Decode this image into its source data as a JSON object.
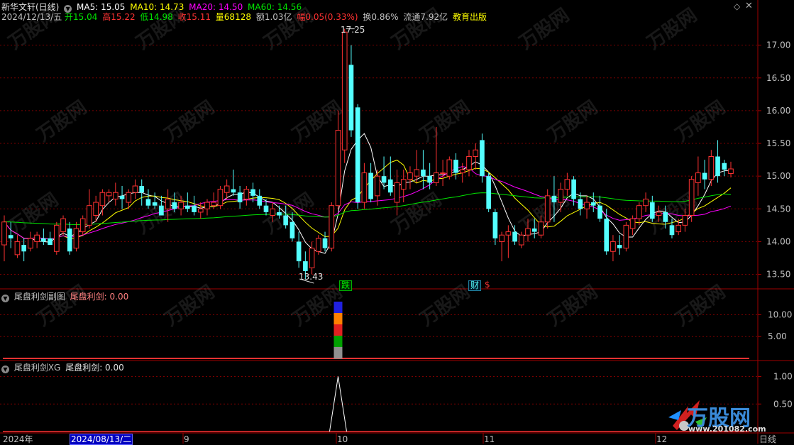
{
  "header": {
    "stock_name": "新华文轩(日线)",
    "ma5": "MA5: 15.05",
    "ma10": "MA10: 14.73",
    "ma20": "MA20: 14.50",
    "ma60": "MA60: 14.56",
    "date": "2024/12/13/五",
    "open": "开15.04",
    "high": "高15.22",
    "low": "低14.98",
    "close": "收15.11",
    "volume": "量68128",
    "amount": "额1.03亿",
    "change": "幅0.05(0.33%)",
    "turnover": "换0.86%",
    "float_cap": "流通7.92亿",
    "sector": "教育出版"
  },
  "colors": {
    "up": "#ff3232",
    "down": "#54ffff",
    "ma5": "#ffffff",
    "ma10": "#ffff00",
    "ma20": "#ff00ff",
    "ma60": "#00e600",
    "grid": "#7a0000",
    "axis_text": "#c0c0c0"
  },
  "price_axis": {
    "ticks": [
      "17.00",
      "16.50",
      "16.00",
      "15.50",
      "15.00",
      "14.50",
      "14.00",
      "13.50"
    ],
    "max_label": "17.25",
    "min_label": "13.43"
  },
  "markers": {
    "down_label": "跌",
    "fin_label": "财",
    "dollar_label": "$"
  },
  "indicator1": {
    "title": "尾盘利剑副图",
    "value": "尾盘利剑: 0.00",
    "ticks": [
      "10.00",
      "5.00"
    ]
  },
  "indicator2": {
    "title": "尾盘利剑XG",
    "value": "尾盘利剑: 0.00",
    "ticks": [
      "1.00",
      "0.50"
    ]
  },
  "time_axis": {
    "year_label": "2024年",
    "cursor_date": "2024/08/13/二",
    "months": [
      "9",
      "10",
      "11",
      "12"
    ],
    "period_label": "日线"
  },
  "watermark": {
    "brand": "万股网",
    "url": "www.201082.com"
  },
  "chart_data": {
    "type": "candlestick",
    "y_range": [
      13.3,
      17.3
    ],
    "candles": [
      {
        "o": 13.95,
        "h": 14.4,
        "l": 13.7,
        "c": 14.3
      },
      {
        "o": 14.1,
        "h": 14.3,
        "l": 13.9,
        "c": 14.05
      },
      {
        "o": 13.8,
        "h": 14.1,
        "l": 13.75,
        "c": 14.0
      },
      {
        "o": 13.95,
        "h": 14.05,
        "l": 13.7,
        "c": 13.85
      },
      {
        "o": 13.9,
        "h": 14.15,
        "l": 13.85,
        "c": 14.05
      },
      {
        "o": 14.0,
        "h": 14.15,
        "l": 13.9,
        "c": 14.1
      },
      {
        "o": 14.05,
        "h": 14.2,
        "l": 13.95,
        "c": 14.0
      },
      {
        "o": 14.05,
        "h": 14.15,
        "l": 13.95,
        "c": 13.95
      },
      {
        "o": 13.85,
        "h": 14.3,
        "l": 13.8,
        "c": 14.25
      },
      {
        "o": 14.15,
        "h": 14.4,
        "l": 14.1,
        "c": 14.35
      },
      {
        "o": 14.2,
        "h": 14.3,
        "l": 13.8,
        "c": 13.85
      },
      {
        "o": 13.9,
        "h": 14.3,
        "l": 13.85,
        "c": 14.2
      },
      {
        "o": 14.15,
        "h": 14.4,
        "l": 14.1,
        "c": 14.35
      },
      {
        "o": 14.25,
        "h": 14.8,
        "l": 14.2,
        "c": 14.55
      },
      {
        "o": 14.4,
        "h": 14.7,
        "l": 14.3,
        "c": 14.6
      },
      {
        "o": 14.55,
        "h": 14.8,
        "l": 14.4,
        "c": 14.75
      },
      {
        "o": 14.7,
        "h": 14.8,
        "l": 14.6,
        "c": 14.75
      },
      {
        "o": 14.65,
        "h": 14.9,
        "l": 14.55,
        "c": 14.75
      },
      {
        "o": 14.7,
        "h": 14.85,
        "l": 14.5,
        "c": 14.65
      },
      {
        "o": 14.6,
        "h": 14.8,
        "l": 14.5,
        "c": 14.75
      },
      {
        "o": 14.75,
        "h": 14.95,
        "l": 14.65,
        "c": 14.85
      },
      {
        "o": 14.85,
        "h": 14.95,
        "l": 14.55,
        "c": 14.75
      },
      {
        "o": 14.65,
        "h": 14.8,
        "l": 14.5,
        "c": 14.55
      },
      {
        "o": 14.6,
        "h": 14.75,
        "l": 14.5,
        "c": 14.55
      },
      {
        "o": 14.55,
        "h": 14.7,
        "l": 14.4,
        "c": 14.4
      },
      {
        "o": 14.5,
        "h": 14.8,
        "l": 14.3,
        "c": 14.65
      },
      {
        "o": 14.6,
        "h": 14.75,
        "l": 14.45,
        "c": 14.5
      },
      {
        "o": 14.5,
        "h": 14.7,
        "l": 14.4,
        "c": 14.6
      },
      {
        "o": 14.55,
        "h": 14.75,
        "l": 14.45,
        "c": 14.5
      },
      {
        "o": 14.55,
        "h": 14.7,
        "l": 14.4,
        "c": 14.45
      },
      {
        "o": 14.45,
        "h": 14.6,
        "l": 14.35,
        "c": 14.5
      },
      {
        "o": 14.5,
        "h": 14.65,
        "l": 14.4,
        "c": 14.6
      },
      {
        "o": 14.55,
        "h": 14.75,
        "l": 14.5,
        "c": 14.6
      },
      {
        "o": 14.55,
        "h": 14.85,
        "l": 14.5,
        "c": 14.8
      },
      {
        "o": 14.75,
        "h": 14.95,
        "l": 14.65,
        "c": 14.85
      },
      {
        "o": 14.8,
        "h": 15.1,
        "l": 14.7,
        "c": 14.75
      },
      {
        "o": 14.75,
        "h": 14.85,
        "l": 14.5,
        "c": 14.6
      },
      {
        "o": 14.65,
        "h": 14.85,
        "l": 14.55,
        "c": 14.8
      },
      {
        "o": 14.8,
        "h": 14.9,
        "l": 14.6,
        "c": 14.7
      },
      {
        "o": 14.7,
        "h": 14.8,
        "l": 14.5,
        "c": 14.55
      },
      {
        "o": 14.55,
        "h": 14.65,
        "l": 14.4,
        "c": 14.45
      },
      {
        "o": 14.4,
        "h": 14.6,
        "l": 14.3,
        "c": 14.5
      },
      {
        "o": 14.45,
        "h": 14.55,
        "l": 14.35,
        "c": 14.4
      },
      {
        "o": 14.4,
        "h": 14.55,
        "l": 14.2,
        "c": 14.25
      },
      {
        "o": 14.3,
        "h": 14.45,
        "l": 14.0,
        "c": 14.05
      },
      {
        "o": 14.0,
        "h": 14.15,
        "l": 13.6,
        "c": 13.7
      },
      {
        "o": 13.7,
        "h": 13.85,
        "l": 13.43,
        "c": 13.55
      },
      {
        "o": 13.6,
        "h": 14.0,
        "l": 13.5,
        "c": 13.9
      },
      {
        "o": 13.85,
        "h": 14.1,
        "l": 13.8,
        "c": 14.05
      },
      {
        "o": 14.05,
        "h": 14.15,
        "l": 13.85,
        "c": 13.9
      },
      {
        "o": 13.9,
        "h": 14.6,
        "l": 13.85,
        "c": 14.55
      },
      {
        "o": 14.55,
        "h": 16.0,
        "l": 14.5,
        "c": 15.7
      },
      {
        "o": 15.4,
        "h": 17.25,
        "l": 15.2,
        "c": 17.2
      },
      {
        "o": 16.7,
        "h": 17.0,
        "l": 15.6,
        "c": 15.7
      },
      {
        "o": 16.05,
        "h": 16.1,
        "l": 14.5,
        "c": 14.6
      },
      {
        "o": 14.6,
        "h": 15.2,
        "l": 14.5,
        "c": 15.05
      },
      {
        "o": 15.05,
        "h": 15.2,
        "l": 14.6,
        "c": 14.65
      },
      {
        "o": 14.7,
        "h": 15.1,
        "l": 14.55,
        "c": 15.0
      },
      {
        "o": 15.0,
        "h": 15.3,
        "l": 14.8,
        "c": 14.9
      },
      {
        "o": 14.95,
        "h": 15.3,
        "l": 14.7,
        "c": 14.75
      },
      {
        "o": 14.6,
        "h": 15.1,
        "l": 14.4,
        "c": 14.9
      },
      {
        "o": 14.8,
        "h": 15.1,
        "l": 14.6,
        "c": 14.95
      },
      {
        "o": 14.95,
        "h": 15.15,
        "l": 14.8,
        "c": 15.05
      },
      {
        "o": 15.0,
        "h": 15.4,
        "l": 14.9,
        "c": 15.1
      },
      {
        "o": 15.1,
        "h": 15.4,
        "l": 14.8,
        "c": 15.0
      },
      {
        "o": 15.0,
        "h": 15.2,
        "l": 14.8,
        "c": 14.9
      },
      {
        "o": 14.9,
        "h": 15.75,
        "l": 14.85,
        "c": 15.05
      },
      {
        "o": 15.05,
        "h": 15.25,
        "l": 14.85,
        "c": 15.05
      },
      {
        "o": 15.0,
        "h": 15.3,
        "l": 14.95,
        "c": 15.25
      },
      {
        "o": 15.25,
        "h": 15.35,
        "l": 14.95,
        "c": 15.05
      },
      {
        "o": 15.05,
        "h": 15.2,
        "l": 14.9,
        "c": 15.1
      },
      {
        "o": 15.1,
        "h": 15.4,
        "l": 15.0,
        "c": 15.3
      },
      {
        "o": 15.3,
        "h": 15.5,
        "l": 15.1,
        "c": 15.4
      },
      {
        "o": 15.55,
        "h": 15.65,
        "l": 14.9,
        "c": 15.0
      },
      {
        "o": 15.0,
        "h": 15.05,
        "l": 14.45,
        "c": 14.5
      },
      {
        "o": 14.45,
        "h": 14.5,
        "l": 13.95,
        "c": 14.05
      },
      {
        "o": 14.0,
        "h": 14.15,
        "l": 13.7,
        "c": 14.1
      },
      {
        "o": 14.1,
        "h": 14.25,
        "l": 13.75,
        "c": 14.15
      },
      {
        "o": 14.15,
        "h": 14.25,
        "l": 13.95,
        "c": 14.0
      },
      {
        "o": 13.95,
        "h": 14.15,
        "l": 13.9,
        "c": 14.1
      },
      {
        "o": 14.1,
        "h": 14.35,
        "l": 14.0,
        "c": 14.2
      },
      {
        "o": 14.2,
        "h": 14.35,
        "l": 14.05,
        "c": 14.15
      },
      {
        "o": 14.1,
        "h": 14.4,
        "l": 14.05,
        "c": 14.3
      },
      {
        "o": 14.3,
        "h": 14.8,
        "l": 14.2,
        "c": 14.7
      },
      {
        "o": 14.7,
        "h": 15.0,
        "l": 14.3,
        "c": 14.6
      },
      {
        "o": 14.6,
        "h": 14.9,
        "l": 14.45,
        "c": 14.8
      },
      {
        "o": 14.8,
        "h": 15.05,
        "l": 14.7,
        "c": 14.95
      },
      {
        "o": 14.95,
        "h": 15.0,
        "l": 14.55,
        "c": 14.65
      },
      {
        "o": 14.65,
        "h": 14.75,
        "l": 14.4,
        "c": 14.5
      },
      {
        "o": 14.5,
        "h": 14.7,
        "l": 14.35,
        "c": 14.6
      },
      {
        "o": 14.6,
        "h": 14.75,
        "l": 14.45,
        "c": 14.55
      },
      {
        "o": 14.55,
        "h": 14.7,
        "l": 14.3,
        "c": 14.35
      },
      {
        "o": 14.35,
        "h": 14.5,
        "l": 13.8,
        "c": 13.85
      },
      {
        "o": 13.85,
        "h": 14.1,
        "l": 13.7,
        "c": 14.0
      },
      {
        "o": 13.95,
        "h": 14.1,
        "l": 13.8,
        "c": 13.9
      },
      {
        "o": 13.9,
        "h": 14.3,
        "l": 13.85,
        "c": 14.25
      },
      {
        "o": 14.2,
        "h": 14.4,
        "l": 14.1,
        "c": 14.35
      },
      {
        "o": 14.35,
        "h": 14.6,
        "l": 14.25,
        "c": 14.55
      },
      {
        "o": 14.55,
        "h": 14.75,
        "l": 14.45,
        "c": 14.65
      },
      {
        "o": 14.6,
        "h": 14.7,
        "l": 14.3,
        "c": 14.35
      },
      {
        "o": 14.4,
        "h": 14.55,
        "l": 14.3,
        "c": 14.45
      },
      {
        "o": 14.45,
        "h": 14.55,
        "l": 14.2,
        "c": 14.3
      },
      {
        "o": 14.25,
        "h": 14.35,
        "l": 14.05,
        "c": 14.1
      },
      {
        "o": 14.15,
        "h": 14.35,
        "l": 14.1,
        "c": 14.25
      },
      {
        "o": 14.25,
        "h": 14.5,
        "l": 14.15,
        "c": 14.4
      },
      {
        "o": 14.4,
        "h": 15.0,
        "l": 14.3,
        "c": 14.95
      },
      {
        "o": 14.9,
        "h": 15.3,
        "l": 14.7,
        "c": 15.05
      },
      {
        "o": 15.05,
        "h": 15.25,
        "l": 14.8,
        "c": 14.95
      },
      {
        "o": 14.95,
        "h": 15.4,
        "l": 14.85,
        "c": 15.3
      },
      {
        "o": 15.3,
        "h": 15.55,
        "l": 14.9,
        "c": 15.0
      },
      {
        "o": 15.2,
        "h": 15.25,
        "l": 15.0,
        "c": 15.1
      },
      {
        "o": 15.04,
        "h": 15.22,
        "l": 14.98,
        "c": 15.11
      }
    ],
    "indicator1_series": {
      "name": "尾盘利剑",
      "y_range": [
        0,
        13
      ],
      "values": [
        {
          "index": 51,
          "value": 13
        }
      ]
    },
    "indicator2_series": {
      "name": "尾盘利剑",
      "y_range": [
        0,
        1.2
      ],
      "values": [
        {
          "index": 51,
          "value": 1
        }
      ]
    }
  }
}
